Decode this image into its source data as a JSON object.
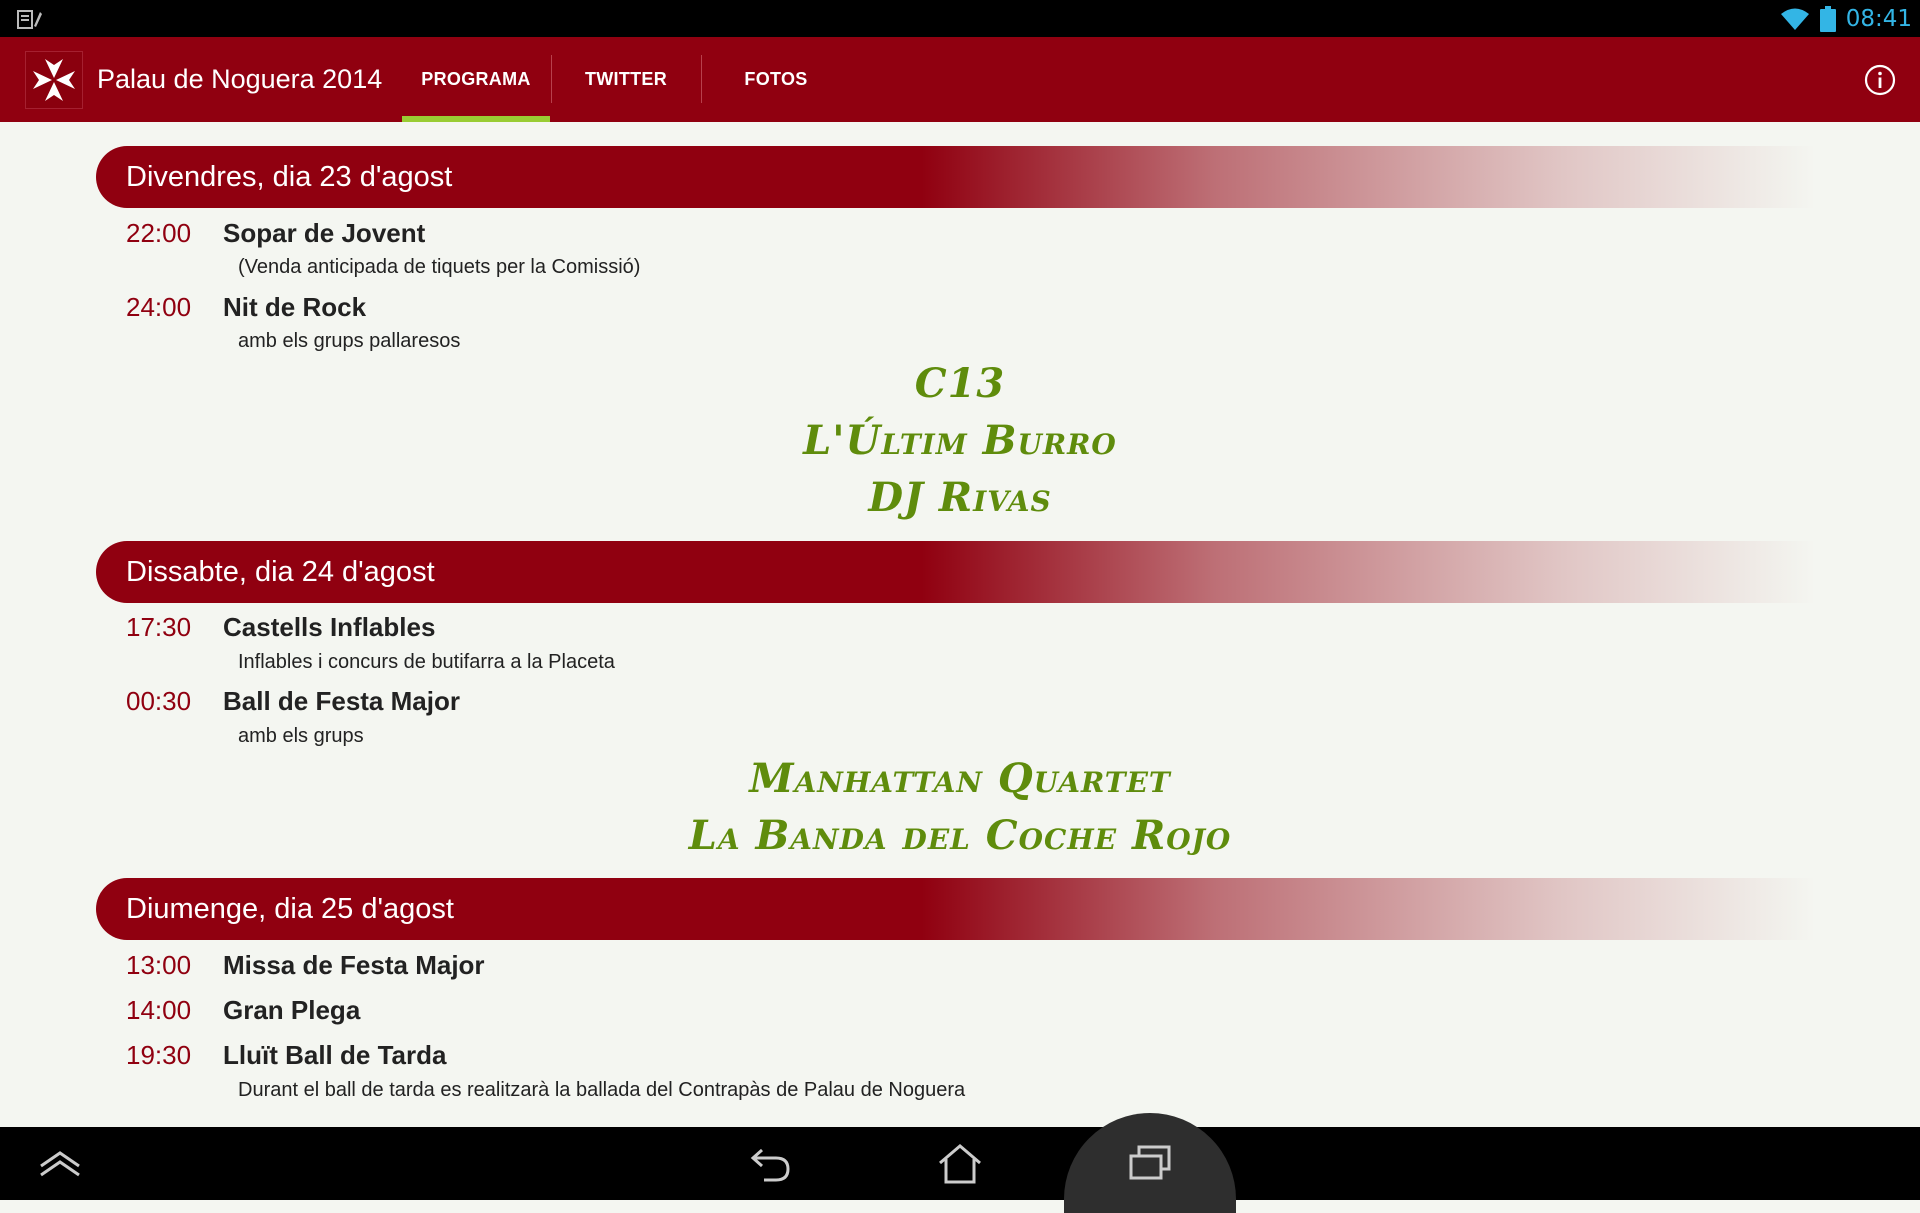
{
  "status_bar": {
    "time": "08:41",
    "left_icon": "notification-sd-icon",
    "icons": [
      "wifi-icon",
      "battery-icon"
    ]
  },
  "action_bar": {
    "title": "Palau de Noguera 2014",
    "logo": "maltese-cross-icon",
    "tabs": [
      {
        "label": "PROGRAMA",
        "selected": true
      },
      {
        "label": "TWITTER",
        "selected": false
      },
      {
        "label": "FOTOS",
        "selected": false
      }
    ],
    "info_icon": "info-icon"
  },
  "days": [
    {
      "header": "Divendres, dia 23 d'agost",
      "events": [
        {
          "time": "22:00",
          "title": "Sopar de Jovent",
          "desc": "(Venda anticipada de tiquets per la Comissió)"
        },
        {
          "time": "24:00",
          "title": "Nit de Rock",
          "desc": "amb els grups pallaresos"
        }
      ],
      "bands": [
        "C13",
        "L'Últim Burro",
        "DJ Rivas"
      ]
    },
    {
      "header": "Dissabte, dia 24 d'agost",
      "events": [
        {
          "time": "17:30",
          "title": "Castells Inflables",
          "desc": "Inflables i concurs de butifarra a la Placeta"
        },
        {
          "time": "00:30",
          "title": "Ball de Festa Major",
          "desc": "amb els grups"
        }
      ],
      "bands": [
        "Manhattan Quartet",
        "La Banda del Coche Rojo"
      ]
    },
    {
      "header": "Diumenge, dia 25 d'agost",
      "events": [
        {
          "time": "13:00",
          "title": "Missa de Festa Major",
          "desc": ""
        },
        {
          "time": "14:00",
          "title": "Gran Plega",
          "desc": ""
        },
        {
          "time": "19:30",
          "title": "Lluït Ball de Tarda",
          "desc": "Durant el ball de tarda es realitzarà la ballada del Contrapàs de Palau de Noguera"
        }
      ]
    }
  ],
  "nav_bar": {
    "icons": [
      "up-icon",
      "back-icon",
      "home-icon",
      "recents-icon"
    ]
  },
  "colors": {
    "primary": "#900010",
    "tab_indicator": "#99cc33",
    "band_text": "#5f8c0c",
    "status_accent": "#33b5e5"
  }
}
